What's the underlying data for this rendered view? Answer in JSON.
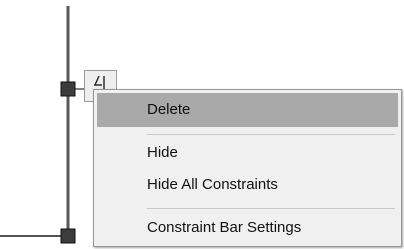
{
  "icons": {
    "constraint_glyph": "perpendicular-constraint-icon",
    "grip_top": "square-grip-icon",
    "grip_bottom": "square-grip-icon"
  },
  "colors": {
    "highlight": "#a9a9a9",
    "menu_background": "#f0f0f0",
    "geometry_line": "#595959",
    "grip_fill": "#3c3c3c"
  },
  "context_menu": {
    "items": [
      {
        "label": "Delete",
        "highlighted": true
      },
      {
        "label": "Hide",
        "highlighted": false
      },
      {
        "label": "Hide All Constraints",
        "highlighted": false
      },
      {
        "label": "Constraint Bar Settings",
        "highlighted": false
      }
    ]
  }
}
